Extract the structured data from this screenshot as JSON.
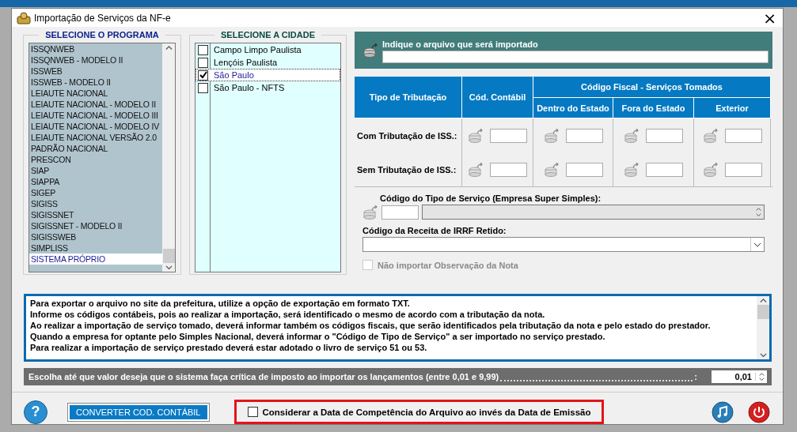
{
  "window": {
    "title": "Importação de Serviços da NF-e",
    "close": "×"
  },
  "program_list": {
    "title": "SELECIONE O PROGRAMA",
    "items": [
      {
        "label": "ISSQNWEB",
        "selected": false
      },
      {
        "label": "ISSQNWEB - MODELO II",
        "selected": false
      },
      {
        "label": "ISSWEB",
        "selected": false
      },
      {
        "label": "ISSWEB - MODELO II",
        "selected": false
      },
      {
        "label": "LEIAUTE NACIONAL",
        "selected": false
      },
      {
        "label": "LEIAUTE NACIONAL - MODELO II",
        "selected": false
      },
      {
        "label": "LEIAUTE NACIONAL - MODELO III",
        "selected": false
      },
      {
        "label": "LEIAUTE NACIONAL - MODELO IV",
        "selected": false
      },
      {
        "label": "LEIAUTE NACIONAL VERSÃO 2.0",
        "selected": false
      },
      {
        "label": "PADRÃO NACIONAL",
        "selected": false
      },
      {
        "label": "PRESCON",
        "selected": false
      },
      {
        "label": "SIAP",
        "selected": false
      },
      {
        "label": "SIAPPA",
        "selected": false
      },
      {
        "label": "SIGEP",
        "selected": false
      },
      {
        "label": "SIGISS",
        "selected": false
      },
      {
        "label": "SIGISSNET",
        "selected": false
      },
      {
        "label": "SIGISSNET - MODELO II",
        "selected": false
      },
      {
        "label": "SIGISSWEB",
        "selected": false
      },
      {
        "label": "SIMPLISS",
        "selected": false
      },
      {
        "label": "SISTEMA PRÓPRIO",
        "selected": true
      }
    ]
  },
  "city_list": {
    "title": "SELECIONE A CIDADE",
    "items": [
      {
        "label": "Campo Limpo Paulista",
        "checked": false,
        "selected": false
      },
      {
        "label": "Lençóis Paulista",
        "checked": false,
        "selected": false
      },
      {
        "label": "São Paulo",
        "checked": true,
        "selected": true
      },
      {
        "label": "São Paulo - NFTS",
        "checked": false,
        "selected": false
      }
    ]
  },
  "import_file": {
    "label": "Indique o arquivo que será importado"
  },
  "tax_table": {
    "type_header": "Tipo de Tributação",
    "account_header": "Cód. Contábil",
    "fiscal_header": "Código Fiscal - Serviços Tomados",
    "fiscal_columns": [
      "Dentro do Estado",
      "Fora do Estado",
      "Exterior"
    ],
    "rows": [
      {
        "label": "Com Tributação de ISS.:"
      },
      {
        "label": "Sem Tributação de ISS.:"
      }
    ]
  },
  "service_type": {
    "label": "Código do Tipo de Serviço (Empresa Super Simples):"
  },
  "irrf": {
    "label": "Código da Receita de IRRF Retido:"
  },
  "skip_notes": {
    "label": "Não importar Observação da Nota",
    "checked": false,
    "disabled": true
  },
  "info_lines": [
    "Para exportar o arquivo no site da prefeitura, utilize a opção de exportação em formato TXT.",
    "Informe os códigos contábeis, pois ao realizar a importação, será identificado o mesmo de acordo com a tributação da nota.",
    "Ao realizar a importação de serviço tomado, deverá informar também os códigos fiscais, que serão identificados pela tributação da nota e pelo estado do prestador.",
    "Quando a empresa for optante pelo Simples Nacional, deverá informar o \"Código de Tipo de Serviço\" a ser importado no serviço prestado.",
    "Para realizar a importação de serviço prestado deverá estar adotado o livro de serviço 51 ou 53."
  ],
  "threshold": {
    "label": "Escolha até que valor deseja que o sistema faça crítica de imposto ao importar os lançamentos (entre 0,01 e 9,99)",
    "separator": ":",
    "value": "0,01"
  },
  "footer": {
    "help": "?",
    "convert_button": "CONVERTER COD. CONTÁBIL",
    "competence": {
      "label": "Considerar a Data de Competência do Arquivo ao invés da Data de Emissão",
      "checked": false
    }
  }
}
